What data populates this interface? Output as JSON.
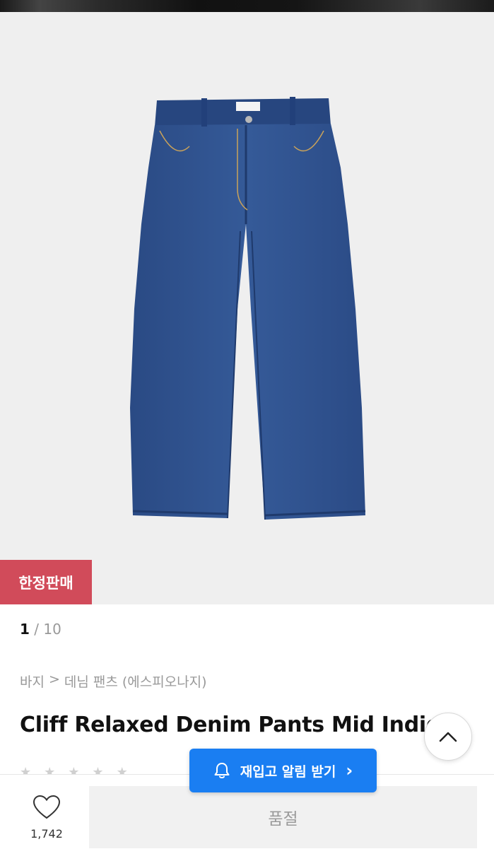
{
  "badge": {
    "label": "한정판매"
  },
  "pager": {
    "current": "1",
    "separator": "/",
    "total": "10"
  },
  "breadcrumb": {
    "category": "바지",
    "separator": ">",
    "subcategory": "데님 팬츠",
    "brand": "(에스피오나지)"
  },
  "product": {
    "title": "Cliff Relaxed Denim Pants Mid Indigo"
  },
  "restock": {
    "label": "재입고 알림 받기",
    "arrow": "›"
  },
  "like": {
    "count": "1,742"
  },
  "purchase": {
    "soldout_label": "품절"
  },
  "colors": {
    "badge": "#d14b5a",
    "restock": "#1a7ef2",
    "denim": "#2e4f8a"
  },
  "icons": {
    "like": "heart-icon",
    "restock": "bell-icon",
    "scroll": "chevron-up-icon"
  }
}
